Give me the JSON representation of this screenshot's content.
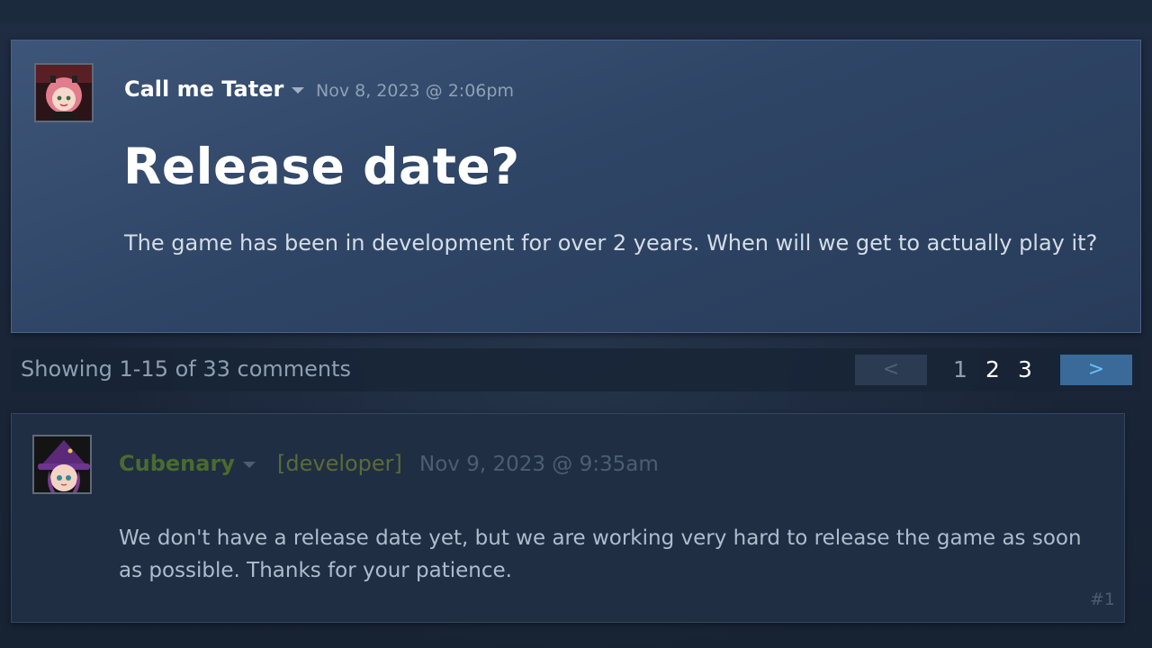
{
  "original_post": {
    "author": "Call me Tater",
    "date": "Nov 8, 2023 @ 2:06pm",
    "title": "Release date?",
    "body": "The game has been in development for over 2 years. When will we get to actually play it?"
  },
  "pagination": {
    "summary": "Showing 1-15 of 33 comments",
    "prev_label": "<",
    "next_label": ">",
    "pages": [
      "1",
      "2",
      "3"
    ],
    "current_page": "1"
  },
  "comments": [
    {
      "author": "Cubenary",
      "role": "[developer]",
      "date": "Nov 9, 2023 @ 9:35am",
      "body": "We don't have a release date yet, but we are working very hard to release the game as soon as possible. Thanks for your patience.",
      "index": "#1"
    }
  ],
  "colors": {
    "op_card": "#34496b",
    "developer_name": "#4b6a2f",
    "next_button": "#3a6a9a",
    "next_arrow": "#67c1f5"
  },
  "icons": {
    "author_menu": "chevron-down-icon",
    "prev": "chevron-left-icon",
    "next": "chevron-right-icon"
  }
}
